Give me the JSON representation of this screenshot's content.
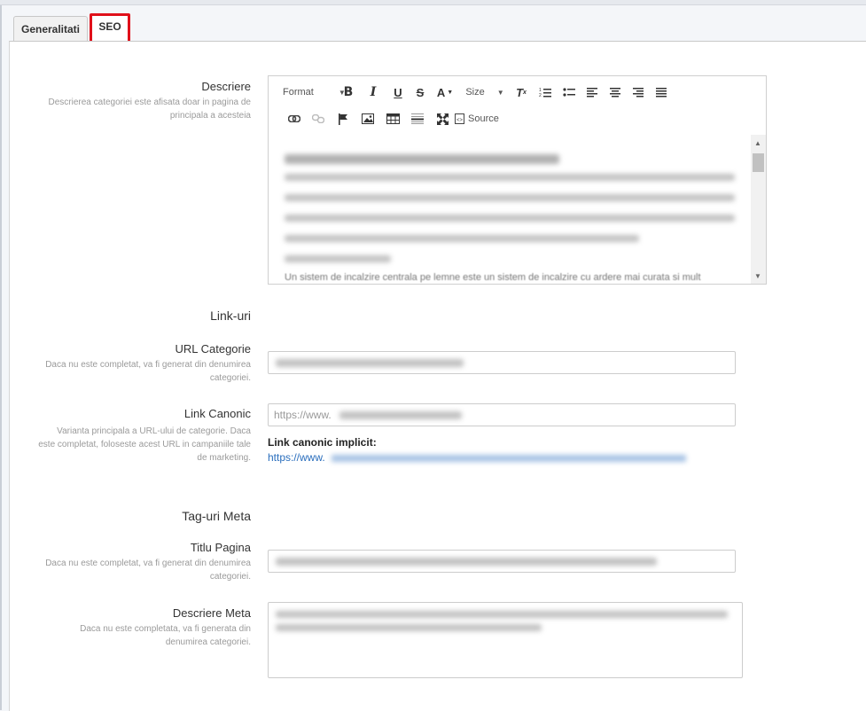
{
  "tabs": [
    {
      "label": "Generalitati",
      "active": false
    },
    {
      "label": "SEO",
      "active": true,
      "highlight_color": "#e0101a"
    }
  ],
  "description": {
    "label": "Descriere",
    "hint": "Descrierea categoriei este afisata doar in pagina de principala a acesteia"
  },
  "editor": {
    "format_label": "Format",
    "size_label": "Size",
    "source_label": "Source",
    "visible_text_fragment": "Un sistem de incalzire centrala pe lemne este un sistem de incalzire cu ardere mai curata si mult"
  },
  "links_section": {
    "title": "Link-uri",
    "url_label": "URL Categorie",
    "url_hint": "Daca nu este completat, va fi generat din denumirea categoriei.",
    "canonical_label": "Link Canonic",
    "canonical_hint": "Varianta principala a URL-ului de categorie. Daca este completat, foloseste acest URL in campaniile tale de marketing.",
    "canonical_value": "https://www.",
    "implicit_label": "Link canonic implicit:",
    "implicit_link": "https://www."
  },
  "meta_section": {
    "title": "Tag-uri Meta",
    "page_title_label": "Titlu Pagina",
    "page_title_hint": "Daca nu este completat, va fi generat din denumirea categoriei.",
    "meta_desc_label": "Descriere Meta",
    "meta_desc_hint": "Daca nu este completata, va fi generata din denumirea categoriei."
  },
  "colors": {
    "link": "#2a6ebd",
    "highlight": "#e0101a"
  }
}
